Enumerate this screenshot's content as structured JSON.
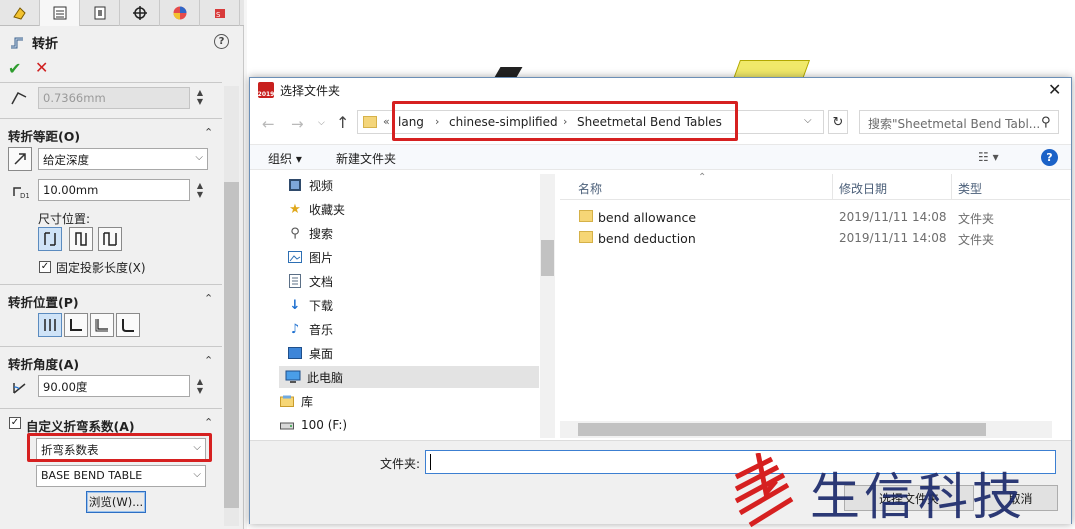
{
  "property_manager": {
    "title": "转折",
    "help": "?",
    "ok": "✔",
    "cancel": "✕",
    "thickness_value": "0.7366mm",
    "section_distance": {
      "title": "转折等距(O)",
      "depth_type": "给定深度",
      "distance_value": "10.00mm",
      "dimension_position_label": "尺寸位置:",
      "fixed_projected_length_label": "固定投影长度(X)",
      "fixed_projected_length_checked": true
    },
    "section_position": {
      "title": "转折位置(P)"
    },
    "section_angle": {
      "title": "转折角度(A)",
      "angle_value": "90.00度"
    },
    "section_custom_bend": {
      "title": "自定义折弯系数(A)",
      "checked": true,
      "type_value": "折弯系数表",
      "table_value": "BASE BEND TABLE",
      "browse_label": "浏览(W)..."
    }
  },
  "dialog": {
    "title": "选择文件夹",
    "app_icon_text": "2019",
    "address": {
      "ellipsis": "«",
      "crumbs": [
        "lang",
        "chinese-simplified",
        "Sheetmetal Bend Tables"
      ]
    },
    "search_placeholder": "搜索\"Sheetmetal Bend Tabl...",
    "toolbar": {
      "organize": "组织 ▾",
      "new_folder": "新建文件夹",
      "view": "☷ ▾"
    },
    "nav_items": [
      "视频",
      "收藏夹",
      "搜索",
      "图片",
      "文档",
      "下载",
      "音乐",
      "桌面",
      "此电脑",
      "库",
      "100 (F:)"
    ],
    "columns": {
      "name": "名称",
      "date": "修改日期",
      "type": "类型"
    },
    "files": [
      {
        "name": "bend allowance",
        "date": "2019/11/11 14:08",
        "type": "文件夹"
      },
      {
        "name": "bend deduction",
        "date": "2019/11/11 14:08",
        "type": "文件夹"
      }
    ],
    "folder_label": "文件夹:",
    "folder_value": "",
    "select_button": "选择文件夹",
    "cancel_button": "取消"
  },
  "watermark": "生信科技",
  "colors": {
    "highlight": "#d62020",
    "accent": "#3c7fd1"
  }
}
